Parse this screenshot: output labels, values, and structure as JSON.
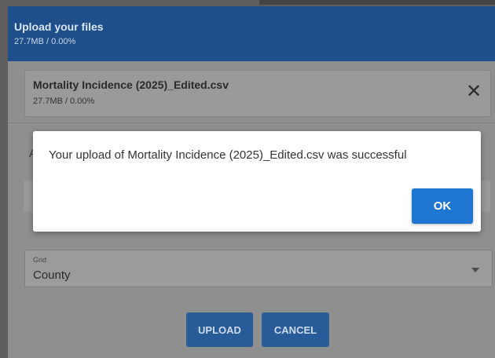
{
  "upload_dialog": {
    "title": "Upload your files",
    "summary": "27.7MB / 0.00%",
    "file": {
      "name": "Mortality Incidence (2025)_Edited.csv",
      "progress": "27.7MB / 0.00%"
    },
    "partial_label": "A",
    "grid": {
      "label": "Grid",
      "value": "County"
    },
    "upload_label": "UPLOAD",
    "cancel_label": "CANCEL"
  },
  "success_modal": {
    "message": "Your upload of Mortality Incidence (2025)_Edited.csv was successful",
    "ok_label": "OK"
  },
  "colors": {
    "header": "#1f4f8a",
    "ok_button": "#1e76d0"
  },
  "icons": {
    "close": "close-icon",
    "dropdown": "chevron-down-icon"
  }
}
